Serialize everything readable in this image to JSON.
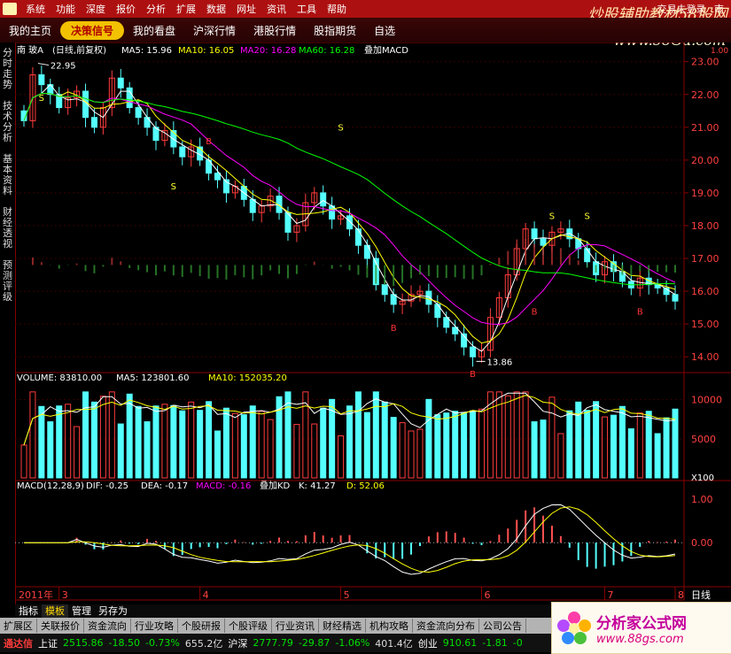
{
  "menubar": {
    "items": [
      "系统",
      "功能",
      "深度",
      "报价",
      "分析",
      "扩展",
      "数据",
      "网址",
      "资讯",
      "工具",
      "帮助"
    ],
    "status_text": "交易未登录",
    "status_suffix": "南",
    "watermark_cn": "炒股辅助教材58股网",
    "watermark_url": "www.58Gu.com"
  },
  "tabbar": {
    "tabs": [
      {
        "label": "我的主页",
        "active": false
      },
      {
        "label": "决策信号",
        "active": true
      },
      {
        "label": "我的看盘",
        "active": false
      },
      {
        "label": "沪深行情",
        "active": false
      },
      {
        "label": "港股行情",
        "active": false
      },
      {
        "label": "股指期货",
        "active": false
      },
      {
        "label": "自选",
        "active": false
      }
    ]
  },
  "sidebar": {
    "items": [
      "分时走势",
      "技术分析",
      "基本资料",
      "财经透视",
      "预测评级"
    ]
  },
  "price_panel": {
    "stock_short": "南 玻A",
    "period": "(日线,前复权)",
    "ma5_label": "MA5: 15.96",
    "ma10_label": "MA10: 16.05",
    "ma20_label": "MA20: 16.28",
    "ma60_label": "MA60: 16.28",
    "overlay": "叠加MACD",
    "high_note": "22.95",
    "low_note": "13.86",
    "y_ticks": [
      "23.00",
      "22.00",
      "21.00",
      "20.00",
      "19.00",
      "18.00",
      "17.00",
      "16.00",
      "15.00",
      "14.00"
    ],
    "y_range": [
      13.6,
      23.1
    ],
    "top_right_small": "1.00"
  },
  "volume_panel": {
    "label": "VOLUME: 83810.00",
    "ma5_label": "MA5: 123801.60",
    "ma10_label": "MA10: 152035.20",
    "y_ticks": [
      "10000",
      "5000"
    ],
    "unit": "X100",
    "y_max": 12000
  },
  "macd_panel": {
    "label": "MACD(12,28,9)",
    "dif_label": "DIF: -0.25",
    "dea_label": "DEA: -0.17",
    "macd_label": "MACD: -0.16",
    "overlay": "叠加KD",
    "k_label": "K: 41.27",
    "d_label": "D: 52.06",
    "y_ticks": [
      "1.00",
      "0.00"
    ]
  },
  "axis": {
    "year_label": "2011年",
    "month_labels": [
      "3",
      "4",
      "5",
      "6",
      "7",
      "8"
    ],
    "period_label": "日线"
  },
  "signals": {
    "s_label": "S",
    "b_label": "B"
  },
  "chart_data": {
    "type": "candlestick",
    "title": "南 玻A (日线,前复权)",
    "series": [
      {
        "name": "MA5",
        "value": 15.96
      },
      {
        "name": "MA10",
        "value": 16.05
      },
      {
        "name": "MA20",
        "value": 16.28
      },
      {
        "name": "MA60",
        "value": 16.28
      }
    ],
    "period_high": 22.95,
    "period_low": 13.86,
    "close_profile": [
      21.2,
      22.6,
      22.3,
      22.0,
      21.6,
      21.9,
      22.1,
      21.3,
      21.0,
      21.6,
      22.5,
      22.2,
      21.6,
      21.3,
      21.0,
      20.6,
      20.9,
      20.4,
      20.1,
      20.4,
      20.0,
      19.6,
      19.4,
      19.0,
      19.2,
      18.8,
      18.4,
      18.6,
      18.9,
      18.4,
      17.8,
      18.0,
      18.7,
      19.0,
      18.6,
      18.2,
      18.3,
      17.9,
      17.4,
      17.0,
      16.2,
      15.9,
      15.6,
      15.7,
      15.9,
      16.0,
      15.6,
      15.2,
      14.9,
      14.7,
      14.3,
      14.0,
      14.2,
      15.2,
      15.8,
      16.5,
      17.3,
      17.9,
      17.6,
      17.4,
      17.8,
      17.9,
      17.6,
      17.3,
      16.9,
      16.5,
      16.9,
      16.6,
      16.3,
      16.1,
      16.4,
      16.2,
      16.1,
      15.9,
      15.7
    ]
  },
  "bottom_tabs": [
    {
      "label": "指标",
      "active": false
    },
    {
      "label": "模板",
      "active": true
    },
    {
      "label": "管理",
      "active": false
    },
    {
      "label": "另存为",
      "active": false
    }
  ],
  "info_bar": [
    "扩展区",
    "关联报价",
    "资金流向",
    "行业攻略",
    "个股研报",
    "个股评级",
    "行业资讯",
    "财经精选",
    "机构攻略",
    "资金流向分布",
    "公司公告"
  ],
  "ticker": {
    "brand": "通达信",
    "items": [
      {
        "text": "上证",
        "color": "#ffffff"
      },
      {
        "text": "2515.86",
        "color": "#00e000"
      },
      {
        "text": "-18.50",
        "color": "#00e000"
      },
      {
        "text": "-0.73%",
        "color": "#00e000"
      },
      {
        "text": "655.2亿",
        "color": "#dddddd"
      },
      {
        "text": "沪深",
        "color": "#ffffff"
      },
      {
        "text": "2777.79",
        "color": "#00e000"
      },
      {
        "text": "-29.87",
        "color": "#00e000"
      },
      {
        "text": "-1.06%",
        "color": "#00e000"
      },
      {
        "text": "401.4亿",
        "color": "#dddddd"
      },
      {
        "text": "创业",
        "color": "#ffffff"
      },
      {
        "text": "910.61",
        "color": "#00e000"
      },
      {
        "text": "-1.81",
        "color": "#00e000"
      },
      {
        "text": "-0",
        "color": "#00e000"
      }
    ]
  },
  "corner_logo": {
    "title": "分析家公式网",
    "url": "www.88gs.com"
  },
  "colors": {
    "up": "#ff3c3c",
    "down": "#54ffff",
    "ma5": "#ffffff",
    "ma10": "#ffff00",
    "ma20": "#ff00ff",
    "ma60": "#00ff00",
    "menu_bg": "#ad1010",
    "tab_active_bg": "#f2c200",
    "grid": "#8a0000"
  }
}
